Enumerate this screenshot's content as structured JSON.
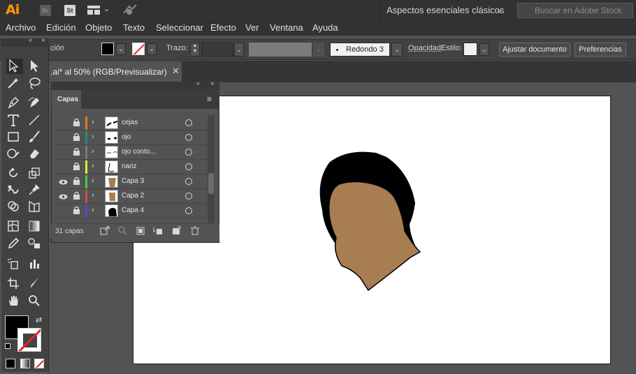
{
  "app": {
    "logo": "Ai",
    "bridge": "Br",
    "stock": "St"
  },
  "workspace": {
    "label": "Aspectos esenciales clásicos"
  },
  "search": {
    "placeholder": "Buscar en Adobe Stock"
  },
  "menu": [
    "Archivo",
    "Edición",
    "Objeto",
    "Texto",
    "Seleccionar",
    "Efecto",
    "Ver",
    "Ventana",
    "Ayuda"
  ],
  "control": {
    "selection_label": "ción",
    "stroke_label": "Trazo:",
    "brush_label": "Redondo 3 ...",
    "opacity_label": "Opacidad",
    "style_label": "Estilo:",
    "align_button": "Ajustar documento",
    "prefs_button": "Preferencias"
  },
  "document": {
    "tab_title": ".ai* al 50% (RGB/Previsualizar)"
  },
  "layers": {
    "tab": "Capas",
    "count": "31 capas",
    "rows": [
      {
        "name": "cejas",
        "color": "#e07c1e",
        "visible": false
      },
      {
        "name": "ojo",
        "color": "#1e8a8a",
        "visible": false
      },
      {
        "name": "ojo conto...",
        "color": "#7a7a7a",
        "visible": false
      },
      {
        "name": "nariz",
        "color": "#e6e63a",
        "visible": false
      },
      {
        "name": "Capa 3",
        "color": "#4ec94e",
        "visible": true
      },
      {
        "name": "Capa 2",
        "color": "#d94a4a",
        "visible": true
      },
      {
        "name": "Capa 4",
        "color": "#4a4ad9",
        "visible": false
      }
    ]
  },
  "colors": {
    "skin": "#a87d52",
    "hair": "#000000",
    "accent": "#ff9a00"
  }
}
